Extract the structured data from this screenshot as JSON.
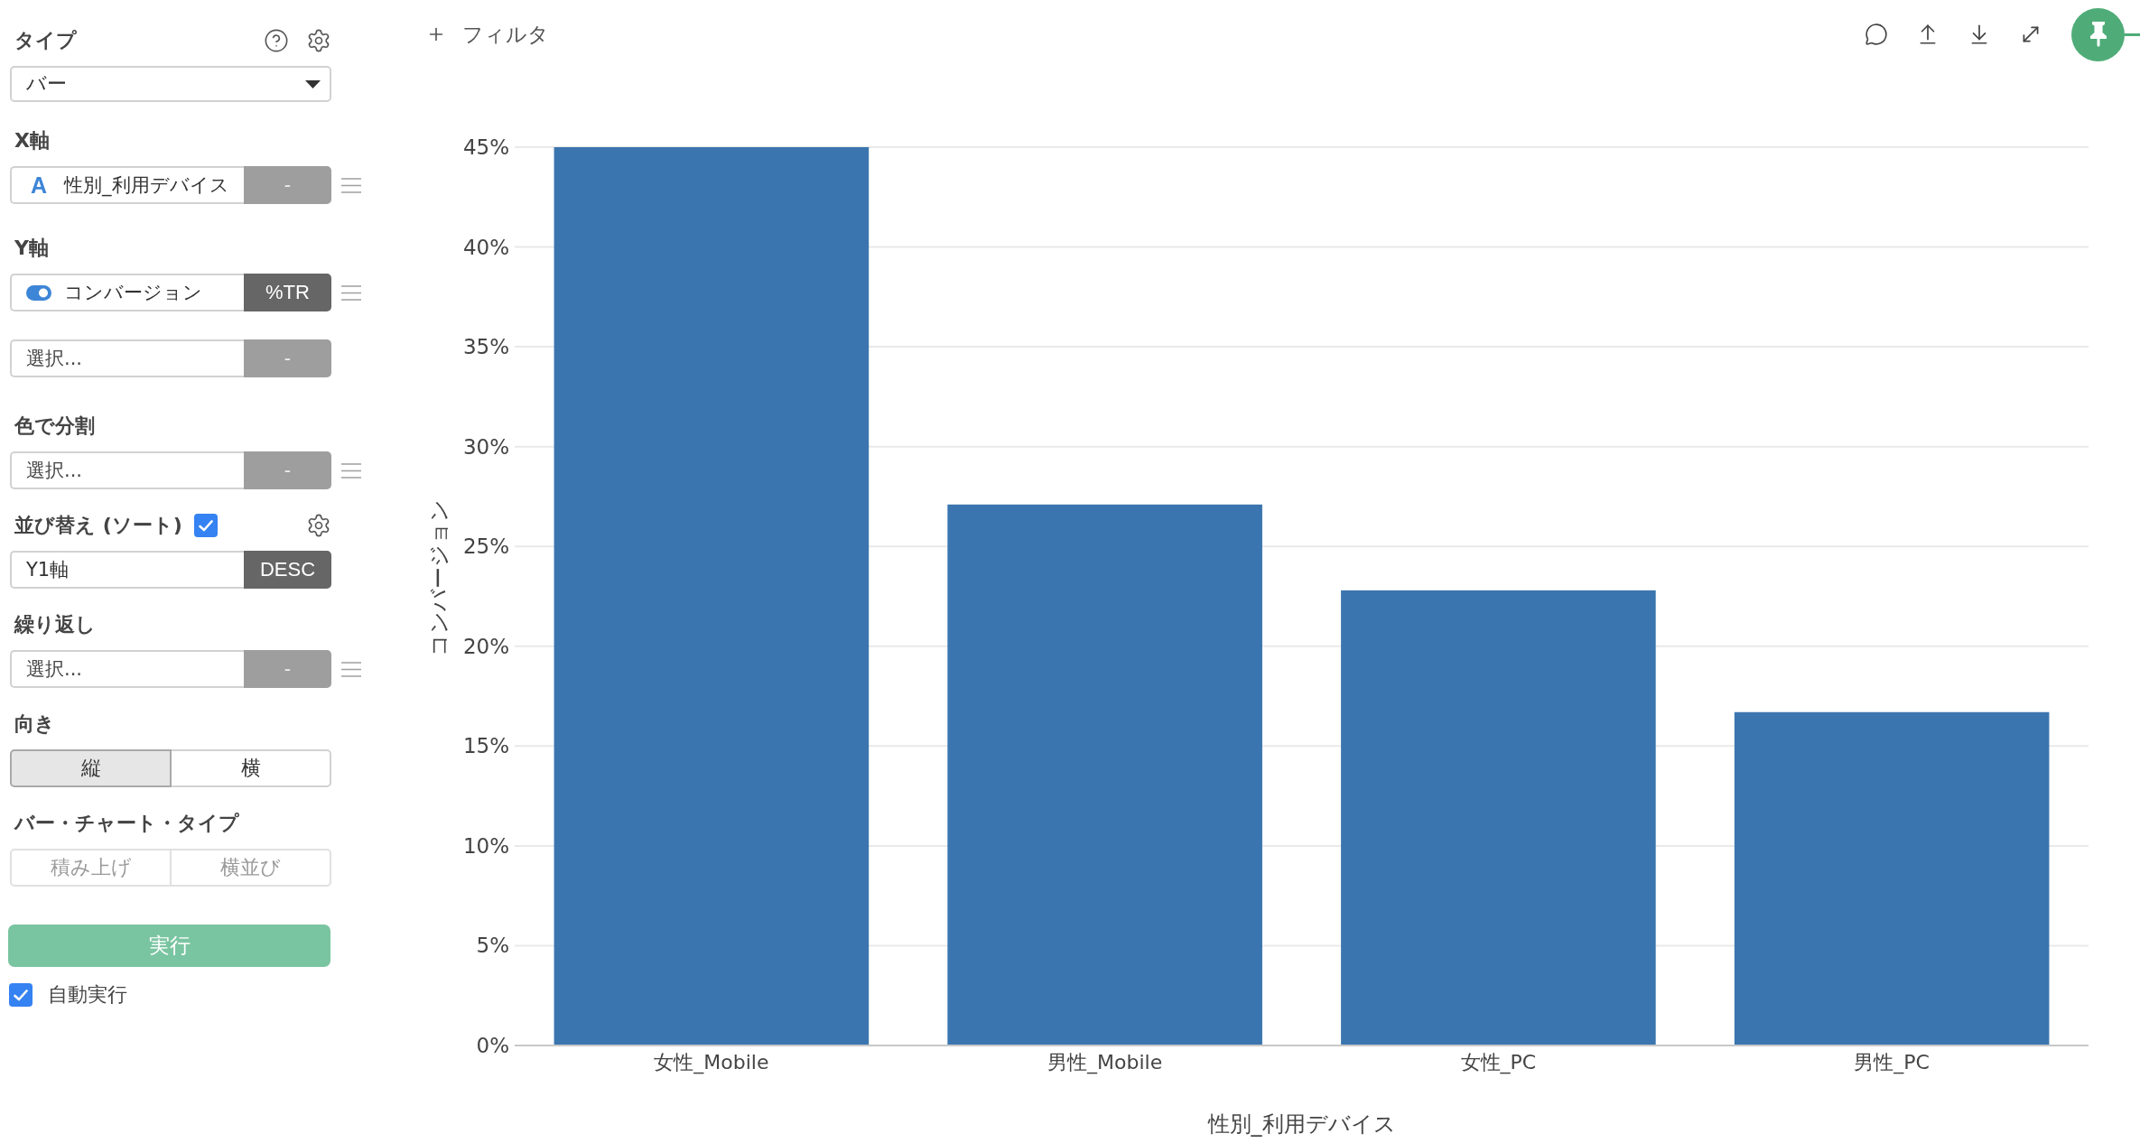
{
  "sidebar": {
    "sections": [
      {
        "kind": "dropdown",
        "label": "タイプ",
        "value": "バー",
        "help": true,
        "settings": true
      },
      {
        "kind": "fields",
        "label": "X軸",
        "fields": [
          {
            "kind": "letter",
            "badge": "A",
            "value": "性別_利用デバイス",
            "action": {
              "label": "-",
              "active": false
            },
            "menu": true
          }
        ]
      },
      {
        "kind": "fields",
        "label": "Y軸",
        "fields": [
          {
            "kind": "toggle",
            "value": "コンバージョン",
            "action": {
              "label": "%TR",
              "active": true
            },
            "menu": true
          },
          {
            "kind": "plain",
            "placeholder": "選択...",
            "action": {
              "label": "-",
              "active": false
            },
            "menu": false
          }
        ]
      },
      {
        "kind": "fields",
        "label": "色で分割",
        "fields": [
          {
            "kind": "plain",
            "placeholder": "選択...",
            "action": {
              "label": "-",
              "active": false
            },
            "menu": true
          }
        ]
      },
      {
        "kind": "fields",
        "label": "並び替え (ソート)",
        "checked": true,
        "settings": true,
        "fields": [
          {
            "kind": "plain",
            "value": "Y1軸",
            "action": {
              "label": "DESC",
              "active": true
            },
            "menu": false
          }
        ]
      },
      {
        "kind": "fields",
        "label": "繰り返し",
        "fields": [
          {
            "kind": "plain",
            "placeholder": "選択...",
            "action": {
              "label": "-",
              "active": false
            },
            "menu": true
          }
        ]
      },
      {
        "kind": "segmented",
        "label": "向き",
        "disabled": false,
        "options": [
          {
            "label": "縦",
            "selected": true
          },
          {
            "label": "横",
            "selected": false
          }
        ]
      },
      {
        "kind": "segmented",
        "label": "バー・チャート・タイプ",
        "disabled": true,
        "options": [
          {
            "label": "積み上げ",
            "selected": false
          },
          {
            "label": "横並び",
            "selected": false
          }
        ]
      }
    ],
    "run_button": "実行",
    "auto_run": {
      "label": "自動実行",
      "checked": true
    }
  },
  "toolbar": {
    "filter_button": "フィルタ",
    "pinned": true
  },
  "chart": {
    "chart_data": {
      "type": "bar",
      "xlabel": "性別_利用デバイス",
      "ylabel": "コンバージョン",
      "categories": [
        "女性_Mobile",
        "男性_Mobile",
        "女性_PC",
        "男性_PC"
      ],
      "series": [
        {
          "color": "#3b75af",
          "values": [
            45,
            27.1,
            22.8,
            16.7
          ]
        }
      ],
      "grid": true,
      "ylim": [
        0,
        45
      ],
      "yticks": [
        {
          "value": 0,
          "label": "0%"
        },
        {
          "value": 5,
          "label": "5%"
        },
        {
          "value": 10,
          "label": "10%"
        },
        {
          "value": 15,
          "label": "15%"
        },
        {
          "value": 20,
          "label": "20%"
        },
        {
          "value": 25,
          "label": "25%"
        },
        {
          "value": 30,
          "label": "30%"
        },
        {
          "value": 35,
          "label": "35%"
        },
        {
          "value": 40,
          "label": "40%"
        },
        {
          "value": 45,
          "label": "45%"
        }
      ]
    }
  }
}
